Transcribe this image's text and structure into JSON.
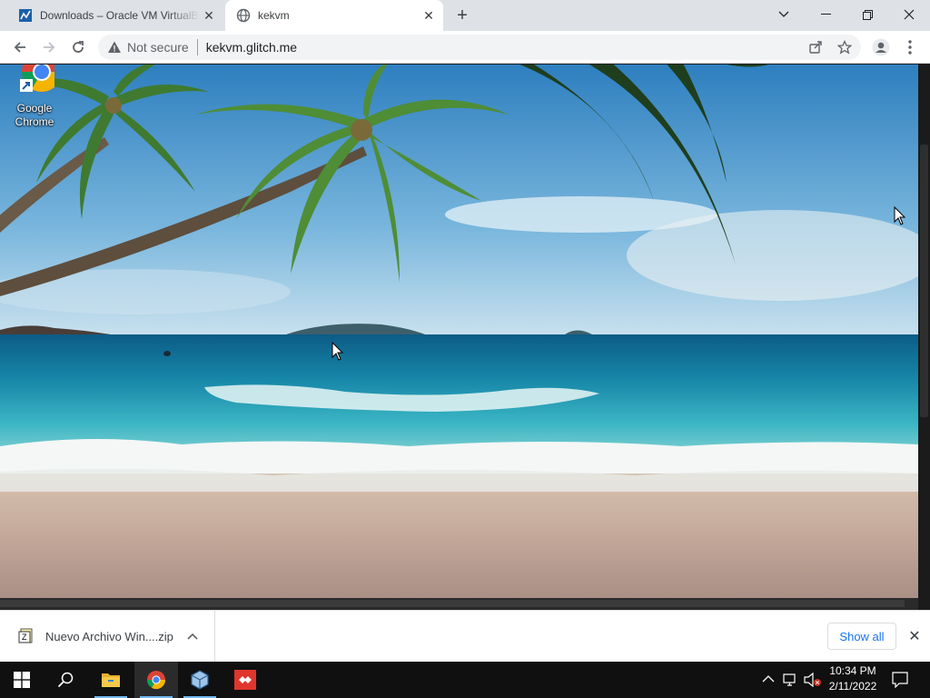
{
  "browser": {
    "tabs": [
      {
        "title": "Downloads – Oracle VM VirtualBox",
        "favicon": "virtualbox-downloads-favicon"
      },
      {
        "title": "kekvm",
        "favicon": "globe-icon"
      }
    ],
    "window_controls": [
      "chevron-down-icon",
      "minimize-icon",
      "restore-icon",
      "close-icon"
    ],
    "omnibox": {
      "security_label": "Not secure",
      "url": "kekvm.glitch.me"
    },
    "toolbar_icons": [
      "back-icon",
      "forward-icon",
      "reload-icon",
      "share-icon",
      "star-icon",
      "profile-icon",
      "menu-icon"
    ]
  },
  "vm": {
    "desktop_icon": {
      "line1": "Google",
      "line2": "Chrome"
    }
  },
  "download_shelf": {
    "item_name": "Nuevo Archivo Win....zip",
    "show_all_label": "Show all"
  },
  "taskbar": {
    "apps": [
      "windows-start-icon",
      "search-icon",
      "file-explorer-icon",
      "chrome-icon",
      "virtualbox-icon",
      "anydesk-icon"
    ],
    "time": "10:34 PM",
    "date": "2/11/2022"
  },
  "colors": {
    "tabstrip": "#dee1e6",
    "link_blue": "#1a73e8",
    "taskbar": "#101010"
  }
}
